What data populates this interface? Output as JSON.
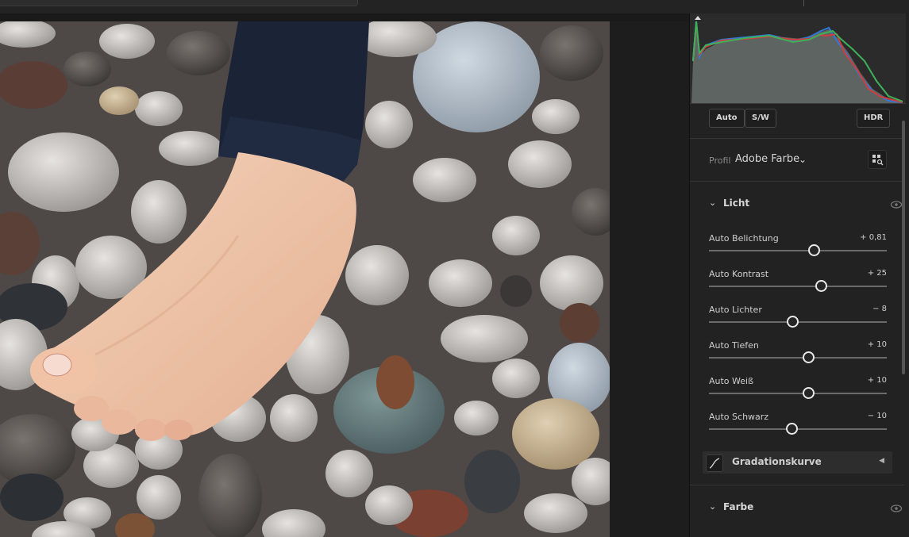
{
  "buttons": {
    "auto": "Auto",
    "bw": "S/W",
    "hdr": "HDR"
  },
  "profile": {
    "label": "Profil",
    "value": "Adobe Farbe",
    "chevron": "⌄"
  },
  "sections": {
    "light": {
      "title": "Licht",
      "arrow": "⌄"
    },
    "color": {
      "title": "Farbe",
      "arrow": "⌄"
    }
  },
  "sliders": [
    {
      "name": "Auto Belichtung",
      "value": "+ 0,81",
      "level": 0.59
    },
    {
      "name": "Auto Kontrast",
      "value": "+ 25",
      "level": 0.63
    },
    {
      "name": "Auto Lichter",
      "value": "− 8",
      "level": 0.47
    },
    {
      "name": "Auto Tiefen",
      "value": "+ 10",
      "level": 0.56
    },
    {
      "name": "Auto Weiß",
      "value": "+ 10",
      "level": 0.56
    },
    {
      "name": "Auto Schwarz",
      "value": "− 10",
      "level": 0.465
    }
  ],
  "curve": {
    "title": "Gradationskurve",
    "toggle": "◀"
  },
  "icons": [
    "photo-image",
    "histogram",
    "grid-search-icon",
    "eye-icon",
    "curve-icon",
    "chevron-down-icon"
  ]
}
